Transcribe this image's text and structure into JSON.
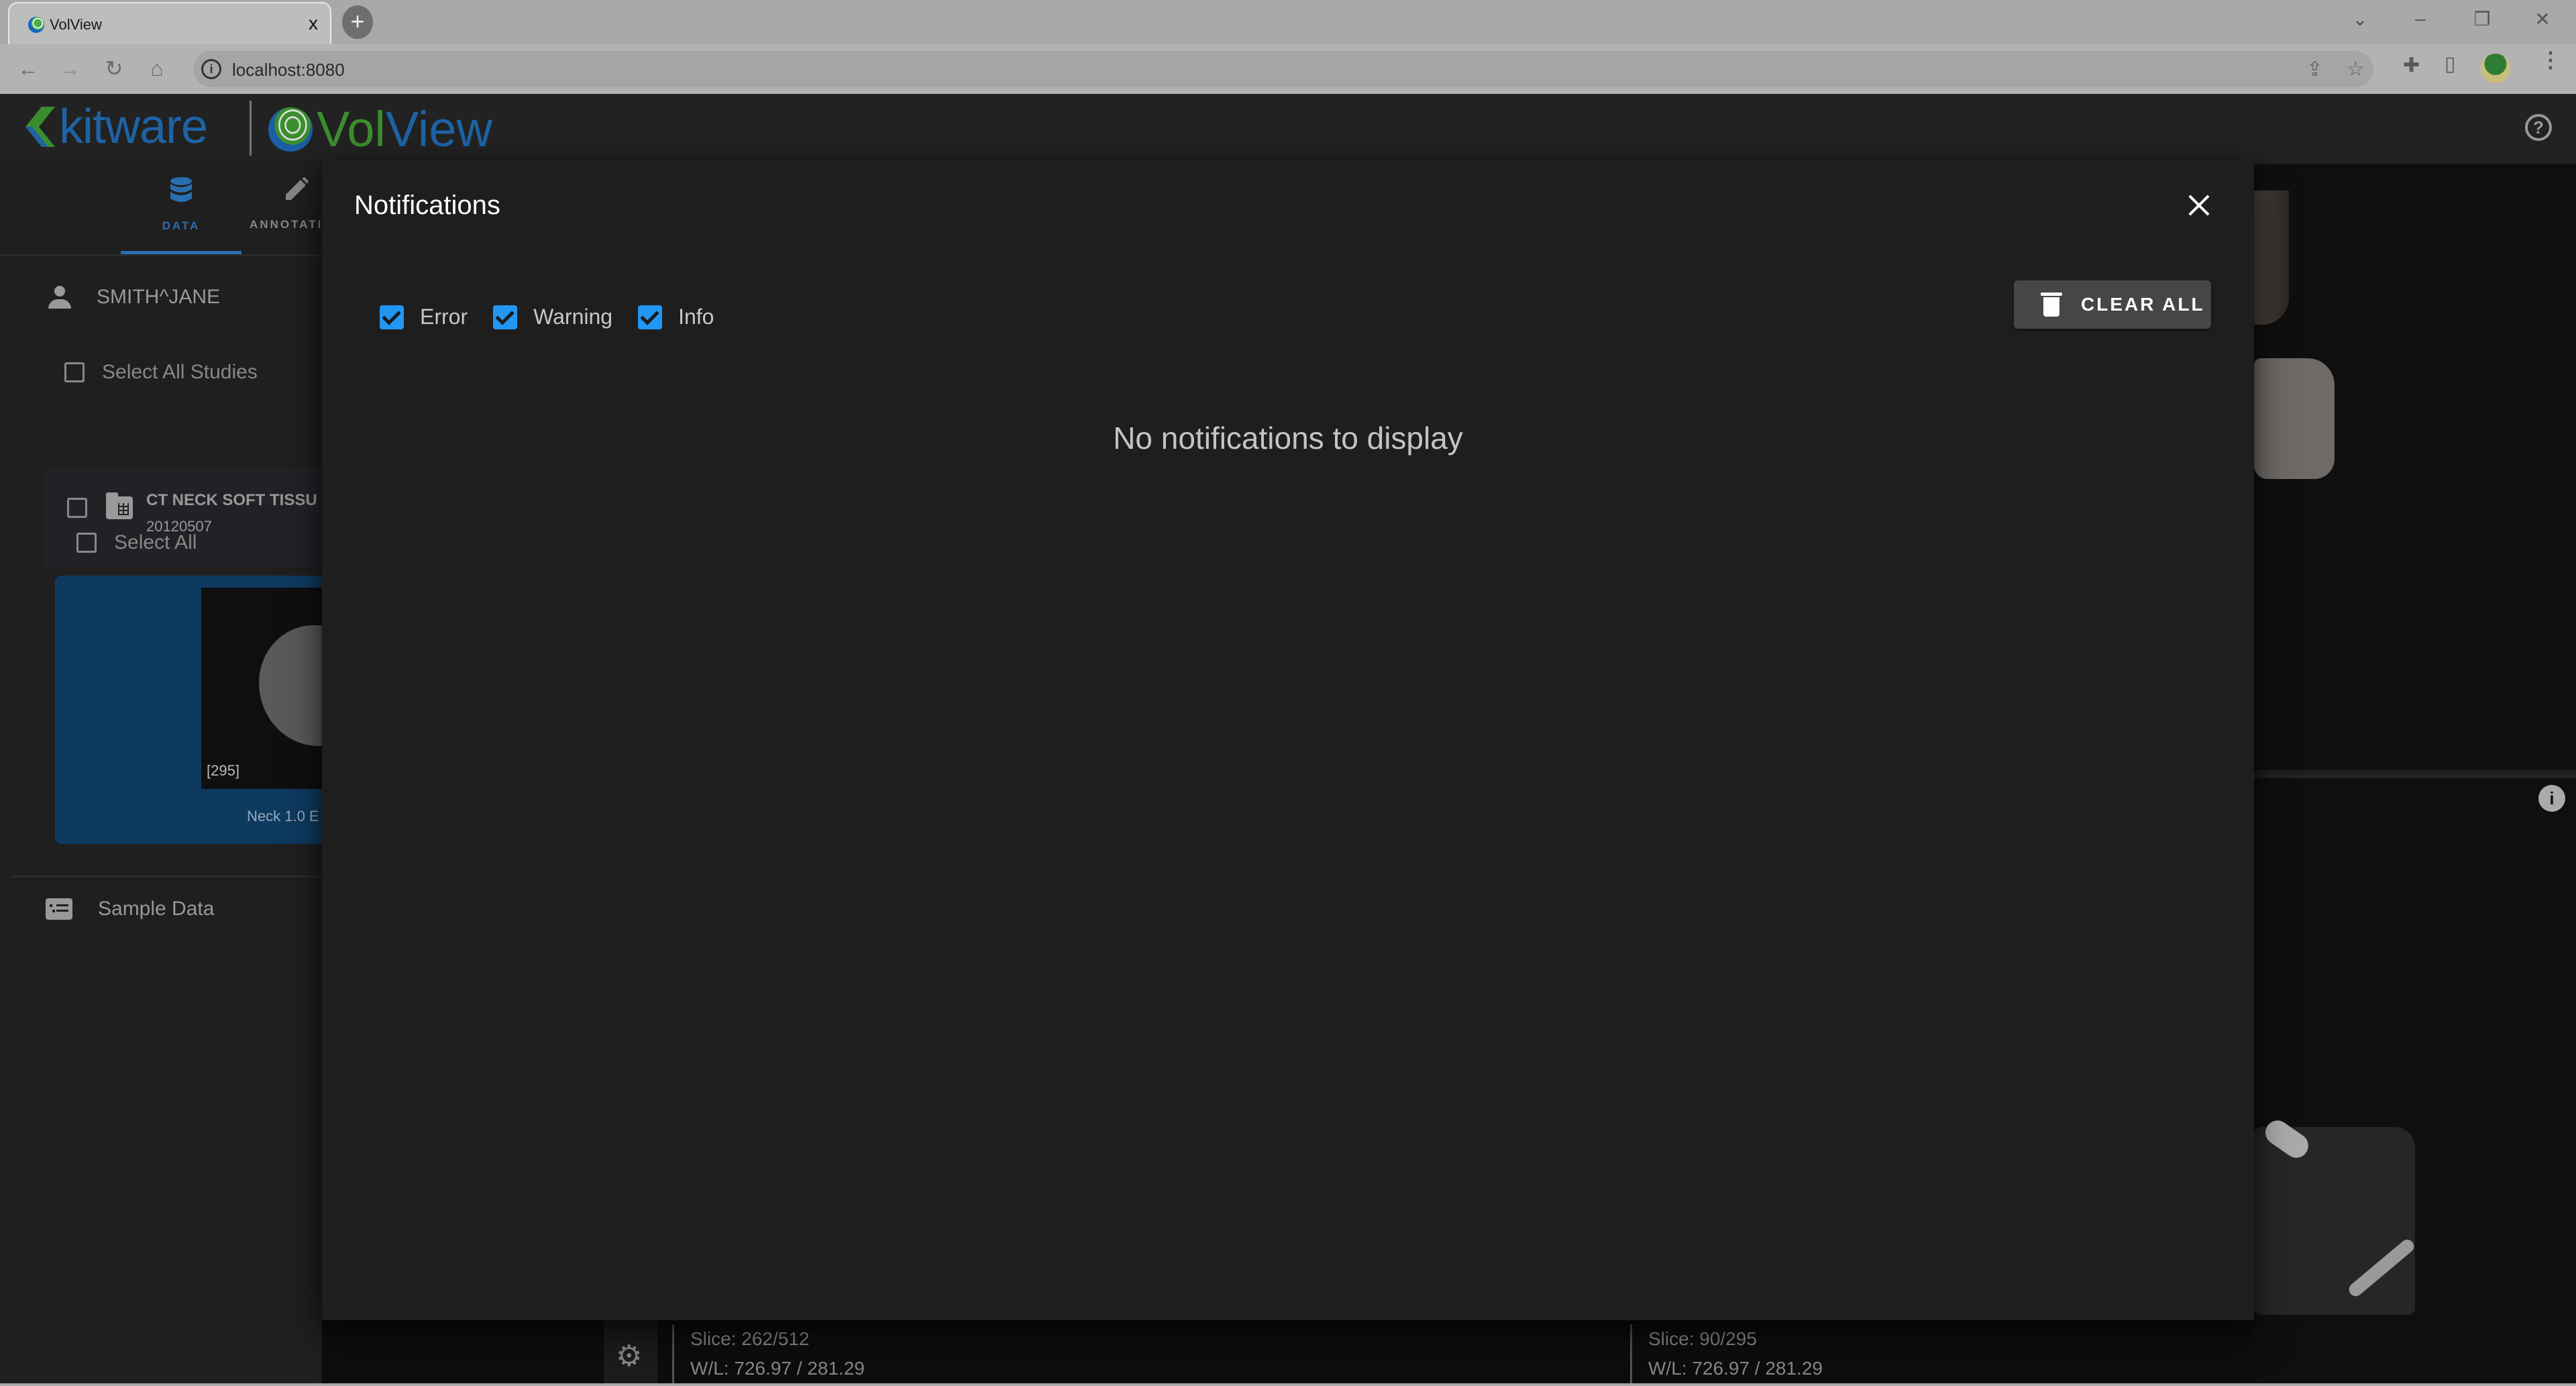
{
  "browser": {
    "tab_title": "VolView",
    "new_tab_label": "+",
    "tab_close": "x",
    "url": "localhost:8080",
    "window_controls": {
      "dropdown": "⌄",
      "minimize": "–",
      "restore": "❐",
      "close": "✕"
    },
    "nav": {
      "back": "←",
      "forward": "→",
      "reload": "↻",
      "home": "⌂"
    },
    "toolbar_icons": {
      "share": "⇪",
      "bookmark": "☆",
      "extensions": "✚",
      "side_panel": "▯",
      "menu": "⋮"
    }
  },
  "app": {
    "brand_kitware": "kitware",
    "brand_vol": "Vol",
    "brand_view": "View",
    "help_label": "?",
    "colors": {
      "kitware_blue": "#1e63a5",
      "volview_green": "#3b8e2e",
      "accent": "#2196f3"
    }
  },
  "sidebar": {
    "tabs": [
      {
        "label": "DATA",
        "icon": "database-icon",
        "active": true
      },
      {
        "label": "ANNOTATI",
        "icon": "pencil-icon",
        "active": false
      }
    ],
    "patient_name": "SMITH^JANE",
    "select_all_studies": "Select All Studies",
    "study": {
      "title": "CT NECK SOFT TISSU",
      "date": "20120507"
    },
    "select_all": "Select All",
    "series": {
      "slice_count": "[295]",
      "name": "Neck 1.0 E"
    },
    "sample_data": "Sample Data"
  },
  "views": {
    "left": {
      "slice": "Slice: 262/512",
      "wl": "W/L: 726.97 / 281.29"
    },
    "right": {
      "slice": "Slice: 90/295",
      "wl": "W/L: 726.97 / 281.29"
    },
    "info_label": "i",
    "settings_label": "⚙"
  },
  "notifications": {
    "title": "Notifications",
    "filters": [
      {
        "label": "Error",
        "checked": true
      },
      {
        "label": "Warning",
        "checked": true
      },
      {
        "label": "Info",
        "checked": true
      }
    ],
    "clear_all_label": "CLEAR ALL",
    "empty_message": "No notifications to display"
  }
}
